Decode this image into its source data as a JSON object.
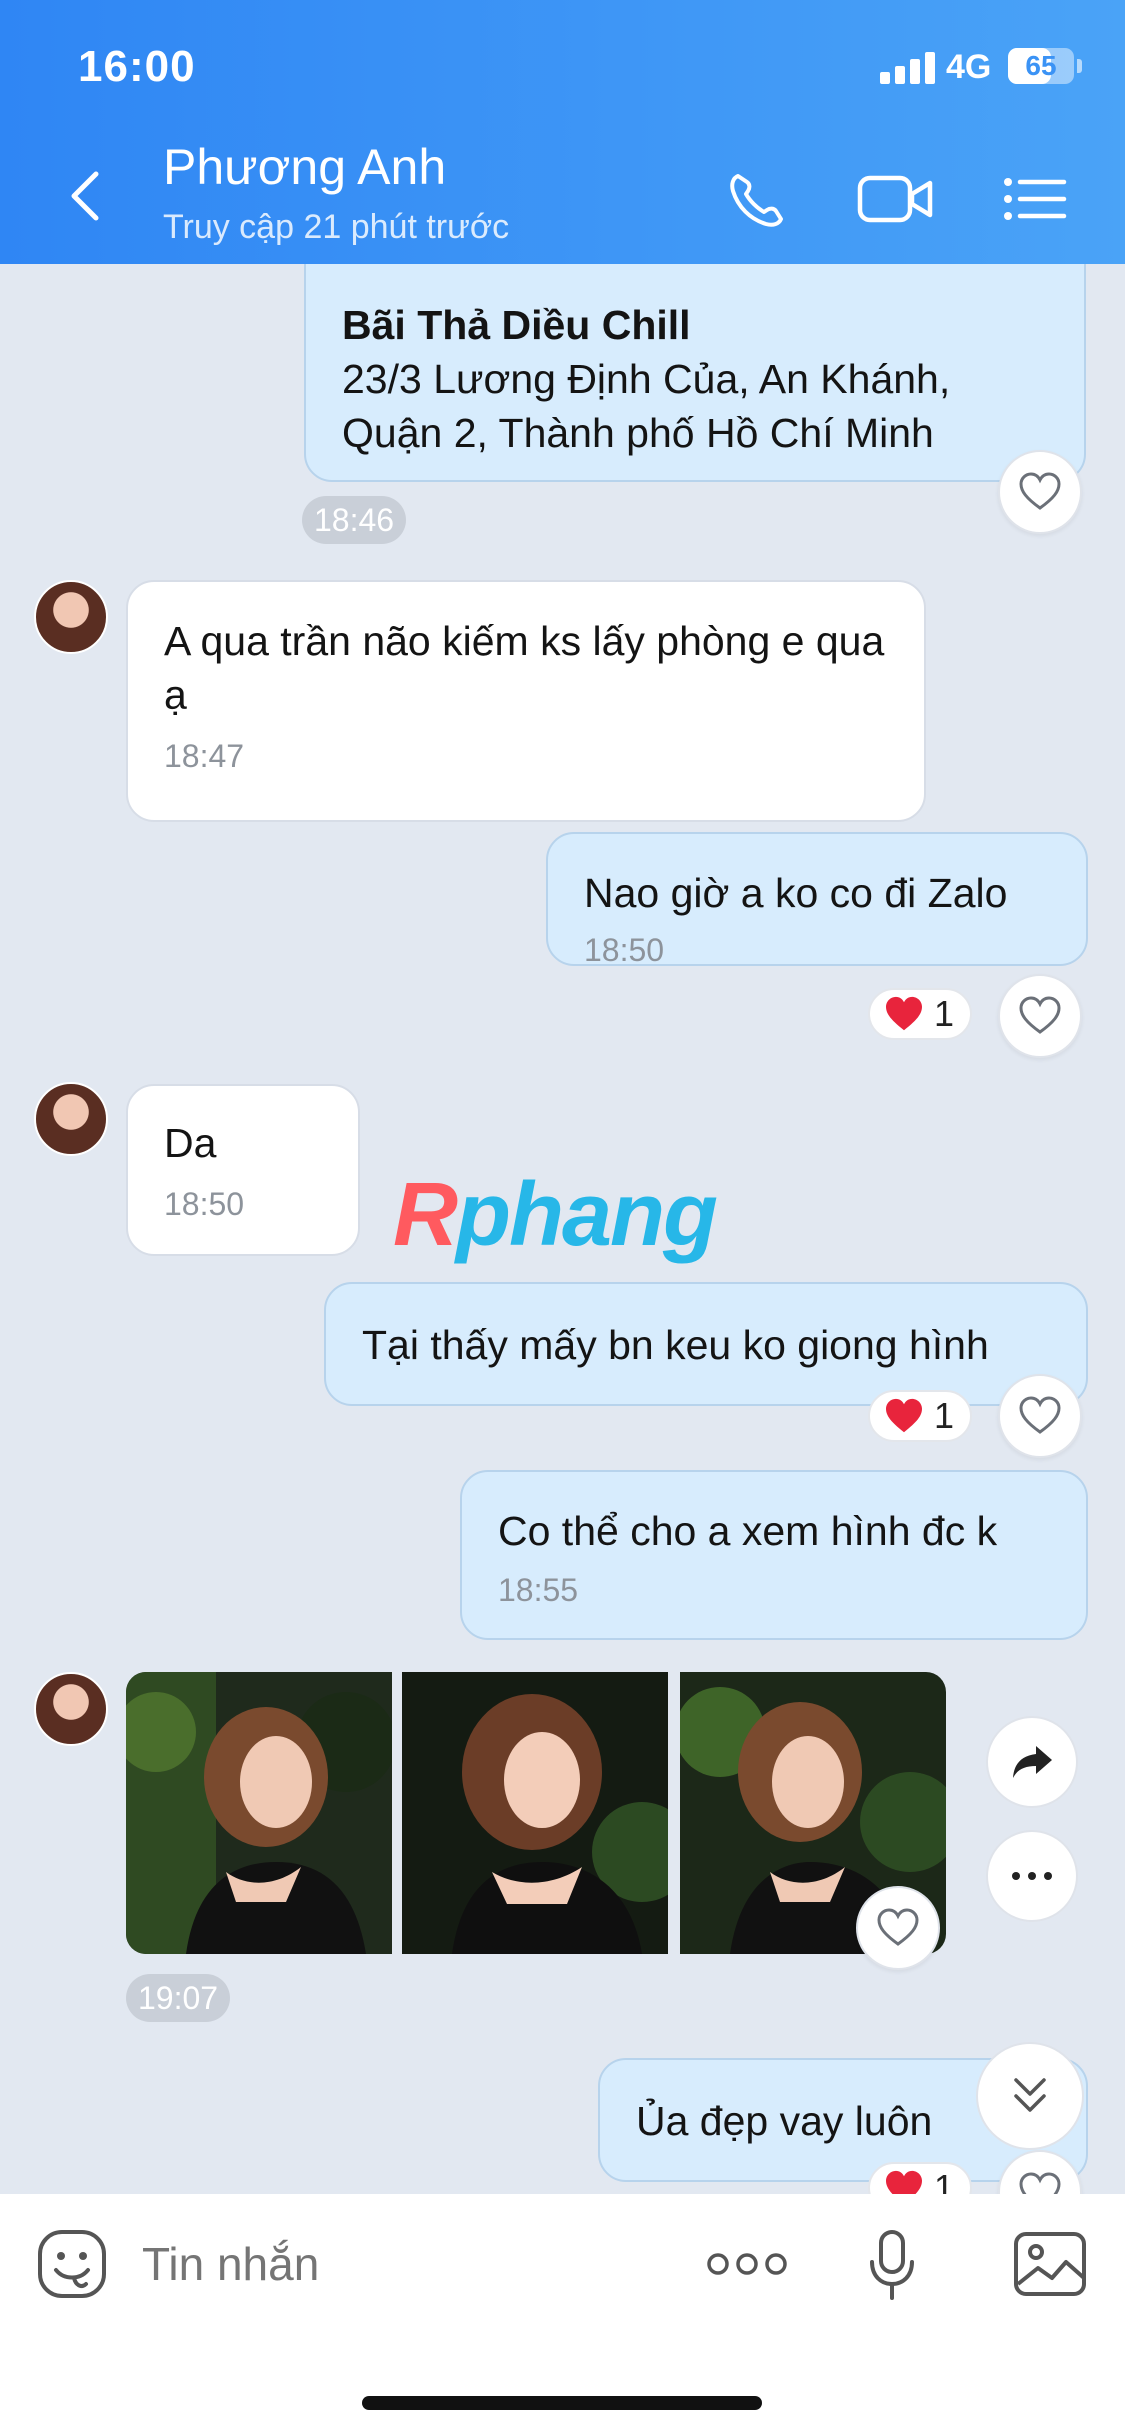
{
  "status_bar": {
    "time": "16:00",
    "network": "4G",
    "battery": "65",
    "battery_level": 0.65
  },
  "header": {
    "contact_name": "Phương Anh",
    "contact_status": "Truy cập 21 phút trước"
  },
  "messages": [
    {
      "direction": "out",
      "type": "location",
      "title": "Bãi Thả Diều Chill",
      "address_line1": "23/3 Lương Định Của, An Khánh,",
      "address_line2": "Quận 2, Thành phố Hồ Chí Minh",
      "time": "18:46"
    },
    {
      "direction": "in",
      "text": "A qua trần não kiếm ks lấy phòng e qua ạ",
      "time": "18:47"
    },
    {
      "direction": "out",
      "text": "Nao giờ a ko co đi Zalo",
      "time": "18:50",
      "reaction_count": "1"
    },
    {
      "direction": "in",
      "text": "Da",
      "time": "18:50"
    },
    {
      "direction": "out",
      "text": "Tại thấy mấy bn keu ko giong hình",
      "reaction_count": "1"
    },
    {
      "direction": "out",
      "text": "Co thể cho a xem hình đc k",
      "time": "18:55"
    },
    {
      "direction": "in",
      "type": "photos",
      "photo_count": 3,
      "time": "19:07"
    },
    {
      "direction": "out",
      "text": "Ủa đẹp vay luôn",
      "reaction_count": "1"
    }
  ],
  "watermark": {
    "part1": "R",
    "part2": "phang"
  },
  "composer": {
    "placeholder": "Tin nhắn"
  },
  "colors": {
    "header_start": "#2f86f4",
    "header_end": "#4aa3f7",
    "outgoing_bubble": "#d7ecfd",
    "incoming_bubble": "#ffffff",
    "chat_bg": "#e2e8f1",
    "heart": "#e8243c"
  },
  "icons": [
    "back-arrow-icon",
    "phone-icon",
    "video-icon",
    "menu-list-icon",
    "heart-outline-icon",
    "heart-filled-icon",
    "share-icon",
    "more-icon",
    "scroll-down-icon",
    "sticker-icon",
    "more-dots-icon",
    "microphone-icon",
    "image-icon"
  ]
}
